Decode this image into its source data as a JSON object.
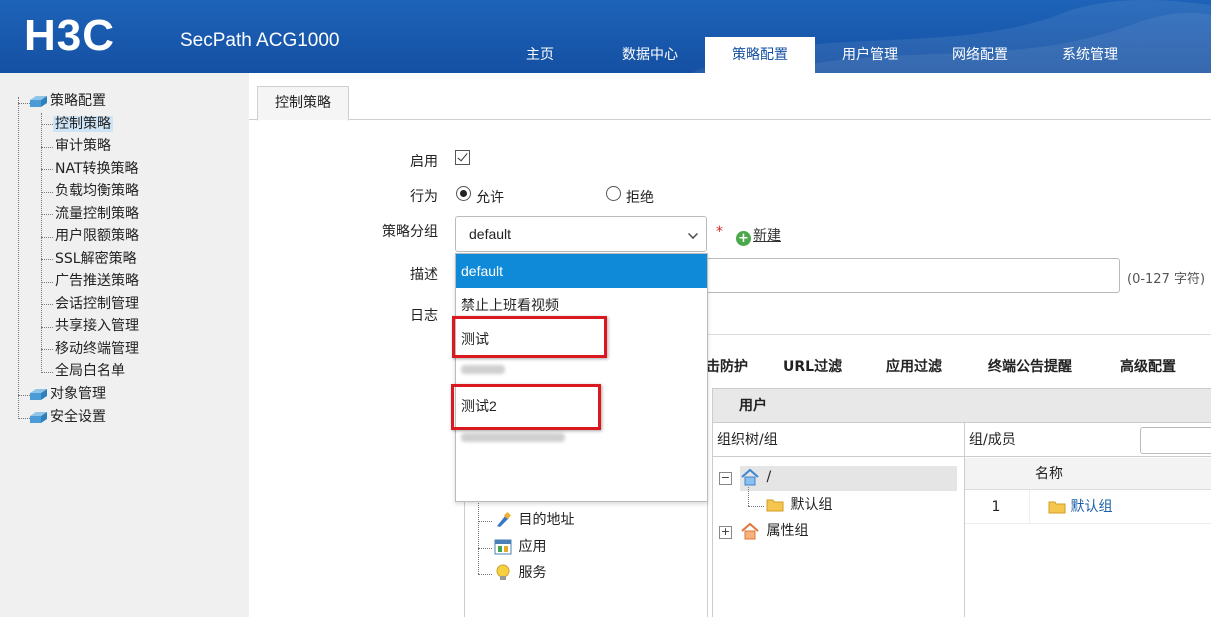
{
  "header": {
    "logo": "H3C",
    "product": "SecPath ACG1000",
    "nav": [
      "主页",
      "数据中心",
      "策略配置",
      "用户管理",
      "网络配置",
      "系统管理"
    ],
    "active_nav": "策略配置"
  },
  "sidebar": {
    "root": "策略配置",
    "items": [
      "控制策略",
      "审计策略",
      "NAT转换策略",
      "负载均衡策略",
      "流量控制策略",
      "用户限额策略",
      "SSL解密策略",
      "广告推送策略",
      "会话控制管理",
      "共享接入管理",
      "移动终端管理",
      "全局白名单"
    ],
    "selected": "控制策略",
    "others": [
      "对象管理",
      "安全设置"
    ]
  },
  "tab": "控制策略",
  "form": {
    "enable_label": "启用",
    "action_label": "行为",
    "allow": "允许",
    "deny": "拒绝",
    "group_label": "策略分组",
    "group_value": "default",
    "required": "*",
    "new_link": "新建",
    "desc_label": "描述",
    "desc_hint": "(0-127 字符)",
    "log_label": "日志"
  },
  "dropdown": {
    "options": [
      "default",
      "禁止上班看视频",
      "测试",
      "",
      "测试2",
      ""
    ],
    "selected": "default",
    "highlighted": [
      "测试",
      "测试2"
    ]
  },
  "subtabs": [
    "击防护",
    "URL过滤",
    "应用过滤",
    "终端公告提醒",
    "高级配置"
  ],
  "left_tree": [
    "目的地址",
    "应用",
    "服务"
  ],
  "users_panel": {
    "title": "用户",
    "org_tree_label": "组织树/组",
    "members_label": "组/成员",
    "root_node": "/",
    "child_node": "默认组",
    "attr_node": "属性组",
    "table_header": "名称",
    "rows": [
      {
        "index": "1",
        "name": "默认组"
      }
    ]
  },
  "colors": {
    "header_blue": "#1550a3",
    "selection_blue": "#0e8ad8",
    "highlight_red": "#d9191f"
  }
}
